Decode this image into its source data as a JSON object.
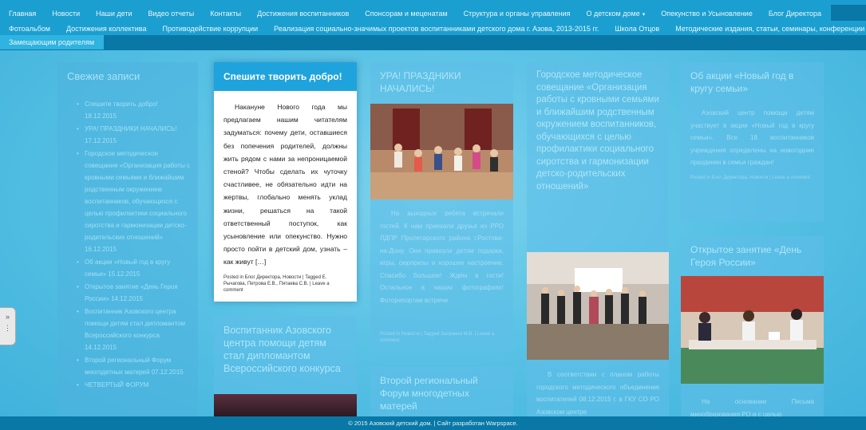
{
  "nav": {
    "row1": [
      "Главная",
      "Новости",
      "Наши дети",
      "Видео отчеты",
      "Контакты",
      "Достижения воспитанников",
      "Спонсорам и меценатам",
      "Структура и органы управления",
      "О детском доме",
      "Опекунство и Усыновление",
      "Блог Директора"
    ],
    "row2": [
      "Фотоальбом",
      "Достижения коллектива",
      "Противодействие коррупции",
      "Реализация социально-значимых проектов воспитанниками детского дома г. Азова, 2013-2015 гг.",
      "Школа Отцов",
      "Методические издания, статьи, семинары, конференции"
    ],
    "row3": [
      "Замещающим родителям"
    ],
    "dropdown_caret": "▾"
  },
  "side_tab": "»",
  "sidebar": {
    "title": "Свежие записи",
    "items": [
      {
        "text": "Спешите творить добро!",
        "date": "18.12.2015"
      },
      {
        "text": "УРА! ПРАЗДНИКИ НАЧАЛИСЬ!",
        "date": "17.12.2015"
      },
      {
        "text": "Городское методическое совещание «Организация работы с кровными семьями и ближайшим родственным окружением воспитанников, обучающихся с целью профилактики социального сиротства и гармонизации детско-родительских отношений»",
        "date": "16.12.2015"
      },
      {
        "text": "Об акции «Новый год в кругу семьи»",
        "date": "15.12.2015"
      },
      {
        "text": "Открытое занятие «День Героя России»",
        "date": "14.12.2015"
      },
      {
        "text": "Воспитанник Азовского центра помощи детям стал дипломантом Всероссийского конкурса",
        "date": "14.12.2015"
      },
      {
        "text": "Второй региональный Форум многодетных матерей",
        "date": "07.12.2015"
      },
      {
        "text": "ЧЕТВЕРТЫЙ ФОРУМ",
        "date": ""
      }
    ]
  },
  "cards": {
    "c1": {
      "title": "Спешите творить добро!",
      "body": "Накануне Нового года мы предлагаем нашим читателям задуматься: почему дети, оставшиеся без попечения родителей, должны жить рядом с нами за непроницаемой стеной? Чтобы сделать их чуточку счастливее, не обязательно идти на жертвы, глобально менять уклад жизни, решаться на такой ответственный поступок, как усыновление или опекунство. Нужно просто пойти в детский дом, узнать – как живут […]",
      "meta": "Posted in Блог Директора, Новости | Tagged Е. Рычагова, Петрова Е.В., Пятаева С.В. | Leave a comment"
    },
    "c2": {
      "title": "Воспитанник Азовского центра помощи детям стал дипломантом Всероссийского конкурса"
    },
    "c3": {
      "title": "УРА! ПРАЗДНИКИ НАЧАЛИСЬ!",
      "body": "На выходных ребята встречали гостей. К нам приехали друзья из РРО ЛДПР Пролетарского района г.Ростова-на-Дону. Они привезли детям подарки, игры, сюрпризы и хорошее настроение. Спасибо большое! Ждём в гости! Остальное в наших фотографиях! Фоторепортаж встречи",
      "meta": "Posted in Новости | Tagged Залунина М.В. | Leave a comment"
    },
    "c4": {
      "title": "Второй региональный Форум многодетных матерей"
    },
    "c5": {
      "title": "Городское методическое совещание «Организация работы с кровными семьями и ближайшим родственным окружением воспитанников, обучающихся с целью профилактики социального сиротства и гармонизации детско-родительских отношений»",
      "body": "В соответствии с планом работы городского методического объединения воспитателей 08.12.2015 г. в ГКУ СО РО Азовском центре"
    },
    "c6": {
      "title": "Об акции «Новый год в кругу семьи»",
      "body": "Азовский центр помощи детям участвует в акции «Новый год в кругу семьи». Все 18 воспитанников учреждения определены на новогодние праздники в семьи граждан!",
      "meta": "Posted in Блог Директора, Новости | Leave a comment"
    },
    "c7": {
      "title": "Открытое занятие «День Героя России»",
      "body": "На основании Письма минобразования РО и с целью"
    }
  },
  "footer": "© 2015 Азовский детский дом. | Сайт разработан Warpspace.",
  "colors": {
    "nav": "#1b9fd0",
    "nav_dark": "#0a78a6",
    "accent": "#1fa3dc",
    "card_dim": "#5fbee8"
  }
}
